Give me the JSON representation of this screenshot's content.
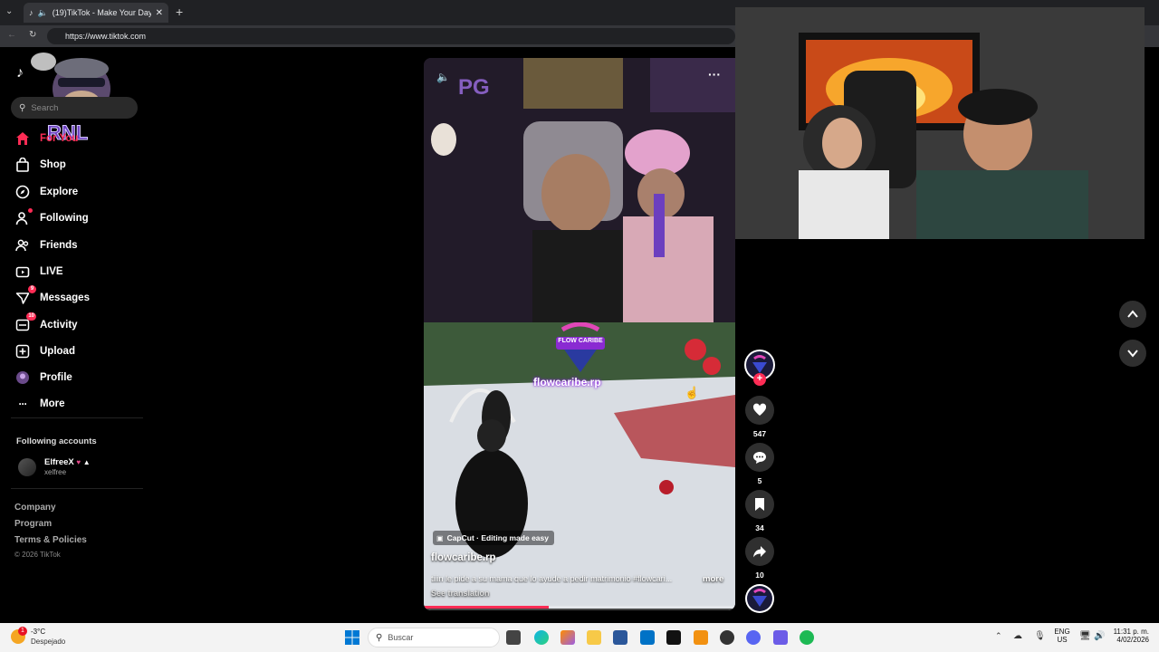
{
  "browser": {
    "tab_title": "(19)TikTok - Make Your Day",
    "url": "https://www.tiktok.com"
  },
  "sidebar": {
    "search_placeholder": "Search",
    "items": [
      {
        "label": "For You",
        "icon": "home-icon"
      },
      {
        "label": "Shop",
        "icon": "shop-icon"
      },
      {
        "label": "Explore",
        "icon": "compass-icon"
      },
      {
        "label": "Following",
        "icon": "following-icon"
      },
      {
        "label": "Friends",
        "icon": "friends-icon"
      },
      {
        "label": "LIVE",
        "icon": "live-icon"
      },
      {
        "label": "Messages",
        "icon": "messages-icon",
        "badge": "9"
      },
      {
        "label": "Activity",
        "icon": "activity-icon",
        "badge": "10"
      },
      {
        "label": "Upload",
        "icon": "upload-icon"
      },
      {
        "label": "Profile",
        "icon": "profile-icon"
      },
      {
        "label": "More",
        "icon": "more-icon"
      }
    ],
    "following_heading": "Following accounts",
    "account_name": "ElfreeX",
    "account_handle": "xelfree",
    "footer": [
      "Company",
      "Program",
      "Terms & Policies"
    ],
    "copyright": "© 2026 TikTok"
  },
  "video": {
    "watermark": "flowcaribe.rp",
    "logo_text": "FLOW CARIBE",
    "sponsor": "CapCut · Editing made easy",
    "author": "flowcaribe.rp",
    "caption": "tiiin le pide a su mama que lo ayude a pedir matrimonio #flowcari...",
    "more": "more",
    "see_translation": "See translation",
    "progress": 0.4
  },
  "actions": {
    "likes": "547",
    "comments": "5",
    "saves": "34",
    "shares": "10"
  },
  "taskbar": {
    "temperature": "-3°C",
    "weather": "Despejado",
    "search_placeholder": "Buscar",
    "lang_top": "ENG",
    "lang_bottom": "US",
    "time": "11:31 p. m.",
    "date": "4/02/2026"
  },
  "colors": {
    "accent": "#fe2c55",
    "background": "#000000",
    "taskbar": "#f3f3f3"
  }
}
